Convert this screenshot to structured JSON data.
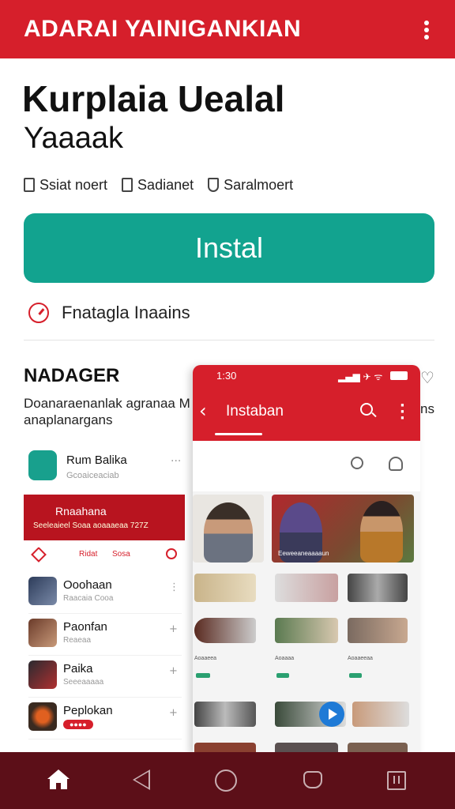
{
  "topbar": {
    "title": "ADARAI YAINIGANKIAN"
  },
  "app": {
    "name": "Kurplaia Uealal",
    "developer": "Yaaaak"
  },
  "meta": [
    {
      "label": "Ssiat noert"
    },
    {
      "label": "Sadianet"
    },
    {
      "label": "Saralmoert"
    }
  ],
  "install": {
    "label": "Instal",
    "color": "#12a38f"
  },
  "feature": {
    "label": "Fnatagla Inaains"
  },
  "section": {
    "title": "NADAGER",
    "desc": "Doanaraenanlak agranaa M anaplanargans",
    "side_text": "ns"
  },
  "left_shot": {
    "app_name": "Rum Balika",
    "app_sub": "Gcoaiceaciab",
    "banner_title": "Rnaahana",
    "banner_sub": "Seeleaieel Soaa aoaaaeaa 727Z",
    "tab1": "Ridat",
    "tab2": "Sosa",
    "items": [
      {
        "name": "Ooohaan",
        "sub": "Raacaia Cooa",
        "action": "⋮"
      },
      {
        "name": "Paonfan",
        "sub": "Reaeaa",
        "action": "+"
      },
      {
        "name": "Paika",
        "sub": "Seeeaaaaa",
        "action": "+"
      },
      {
        "name": "Peplokan",
        "sub": "",
        "action": "+"
      }
    ]
  },
  "right_shot": {
    "time": "1:30",
    "status_icons": "▂▄▆ ✈ ᯤ",
    "title": "Instaban",
    "captions": [
      "Eeweeaneaaaaun",
      "Aoaaeea",
      "Aoaaaa",
      "Aoaaeeaa"
    ]
  },
  "colors": {
    "brand": "#d61f2b",
    "nav": "#5c0f18",
    "accent": "#12a38f"
  }
}
